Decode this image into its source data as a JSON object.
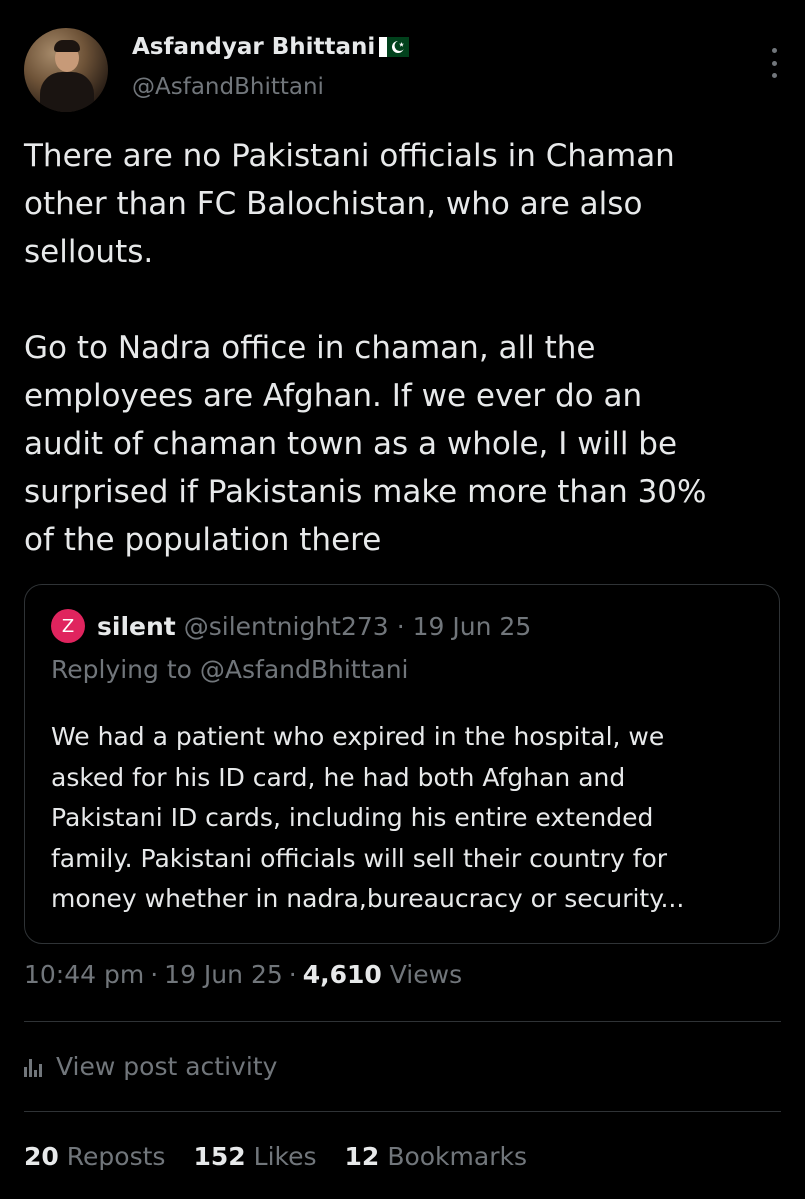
{
  "author": {
    "name": "Asfandyar Bhittani",
    "handle": "@AsfandBhittani",
    "flag_icon": "pakistan-flag-icon"
  },
  "tweet": {
    "text": "There are no Pakistani officials in Chaman\nother than FC Balochistan, who are also\nsellouts.\n\nGo to Nadra office in chaman, all the\nemployees are Afghan. If we ever do an\naudit of chaman town as a whole, I will be\nsurprised if Pakistanis make more than 30%\nof the population there"
  },
  "quote": {
    "avatar_letter": "Z",
    "name": "silent",
    "handle": "@silentnight273",
    "dot": "·",
    "date": "19 Jun 25",
    "replying_to": "Replying to @AsfandBhittani",
    "text": "We had a patient who expired in the hospital, we\nasked for his ID card, he had both Afghan and\nPakistani ID cards, including his entire extended\nfamily. Pakistani officials will sell their country for\nmoney whether in nadra,bureaucracy or security..."
  },
  "meta": {
    "time": "10:44 pm",
    "sep": "·",
    "date": "19 Jun 25",
    "views_count": "4,610",
    "views_label": "Views"
  },
  "activity": {
    "label": "View post activity"
  },
  "stats": {
    "reposts_count": "20",
    "reposts_label": "Reposts",
    "likes_count": "152",
    "likes_label": "Likes",
    "bookmarks_count": "12",
    "bookmarks_label": "Bookmarks"
  },
  "colors": {
    "background": "#000000",
    "text": "#e7e9ea",
    "secondary": "#71767b",
    "border": "#2f3336",
    "quote_avatar": "#e0245e"
  }
}
